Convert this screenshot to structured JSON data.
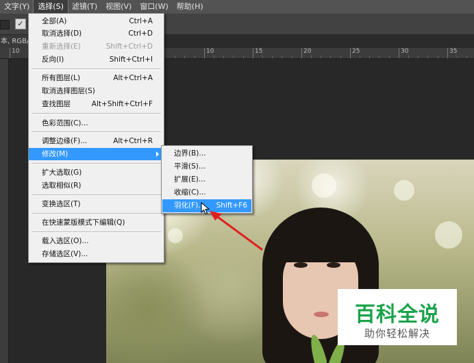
{
  "menubar": {
    "items": [
      "文字(Y)",
      "选择(S)",
      "滤镜(T)",
      "视图(V)",
      "窗口(W)",
      "帮助(H)"
    ]
  },
  "document": {
    "tab_label": "本, RGB/8"
  },
  "ruler": {
    "labels": [
      "10",
      "10",
      "15",
      "20",
      "25",
      "30",
      "35"
    ]
  },
  "select_menu": {
    "items": [
      {
        "label": "全部(A)",
        "shortcut": "Ctrl+A"
      },
      {
        "label": "取消选择(D)",
        "shortcut": "Ctrl+D"
      },
      {
        "label": "重新选择(E)",
        "shortcut": "Shift+Ctrl+D"
      },
      {
        "label": "反向(I)",
        "shortcut": "Shift+Ctrl+I"
      },
      {
        "label": "所有图层(L)",
        "shortcut": "Alt+Ctrl+A"
      },
      {
        "label": "取消选择图层(S)",
        "shortcut": ""
      },
      {
        "label": "查找图层",
        "shortcut": "Alt+Shift+Ctrl+F"
      },
      {
        "label": "色彩范围(C)...",
        "shortcut": ""
      },
      {
        "label": "调整边缘(F)...",
        "shortcut": "Alt+Ctrl+R"
      },
      {
        "label": "修改(M)",
        "shortcut": ""
      },
      {
        "label": "扩大选取(G)",
        "shortcut": ""
      },
      {
        "label": "选取相似(R)",
        "shortcut": ""
      },
      {
        "label": "变换选区(T)",
        "shortcut": ""
      },
      {
        "label": "在快速蒙版模式下编辑(Q)",
        "shortcut": ""
      },
      {
        "label": "载入选区(O)...",
        "shortcut": ""
      },
      {
        "label": "存储选区(V)...",
        "shortcut": ""
      }
    ]
  },
  "modify_submenu": {
    "items": [
      {
        "label": "边界(B)...",
        "shortcut": ""
      },
      {
        "label": "平滑(S)...",
        "shortcut": ""
      },
      {
        "label": "扩展(E)...",
        "shortcut": ""
      },
      {
        "label": "收缩(C)...",
        "shortcut": ""
      },
      {
        "label": "羽化(F)...",
        "shortcut": "Shift+F6"
      }
    ]
  },
  "watermark": {
    "title": "百科全说",
    "subtitle": "助你轻松解决"
  },
  "colors": {
    "highlight": "#3399ff",
    "annotation": "#e02020",
    "watermark_green": "#1aa34a"
  }
}
